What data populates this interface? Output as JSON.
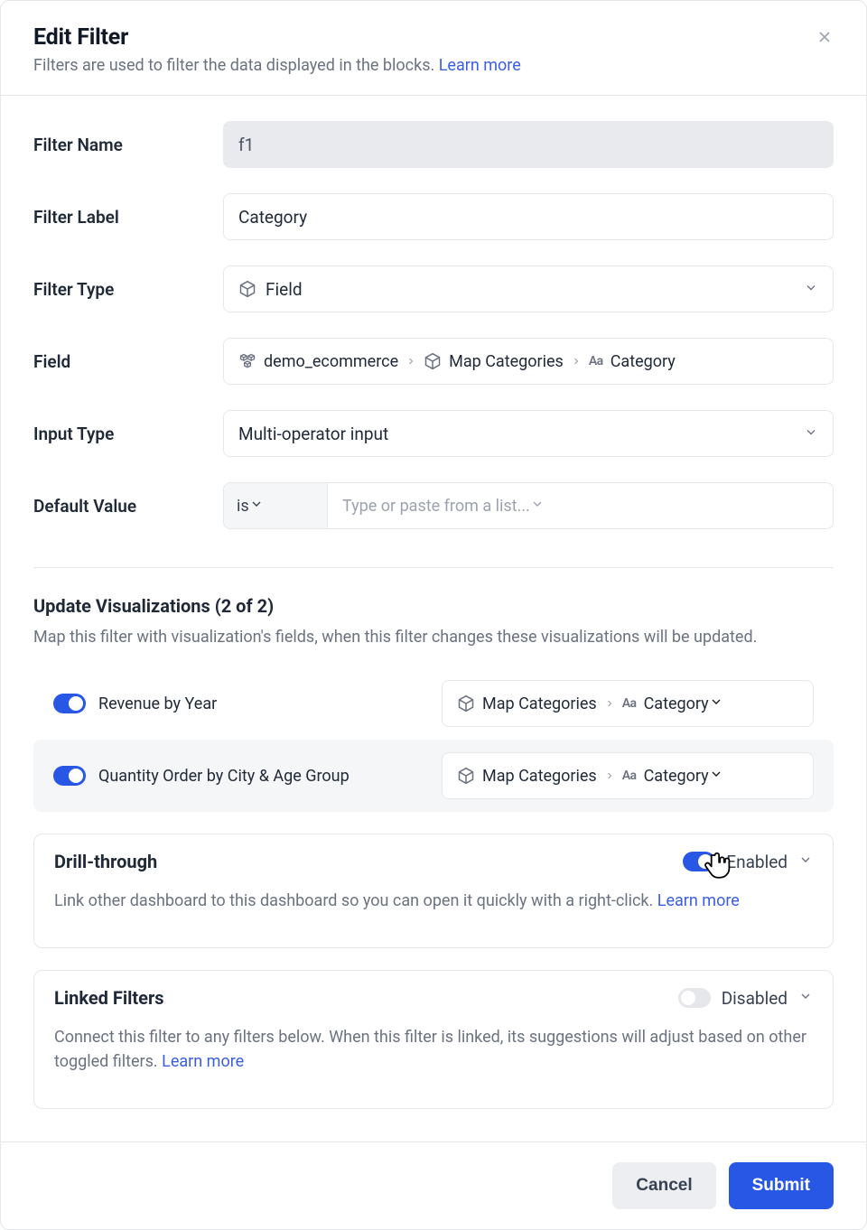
{
  "header": {
    "title": "Edit Filter",
    "subtitle": "Filters are used to filter the data displayed in the blocks.",
    "learn_more": "Learn more"
  },
  "form": {
    "filter_name": {
      "label": "Filter Name",
      "value": "f1"
    },
    "filter_label": {
      "label": "Filter Label",
      "value": "Category"
    },
    "filter_type": {
      "label": "Filter Type",
      "value": "Field"
    },
    "field": {
      "label": "Field",
      "path": [
        "demo_ecommerce",
        "Map Categories",
        "Category"
      ]
    },
    "input_type": {
      "label": "Input Type",
      "value": "Multi-operator input"
    },
    "default_value": {
      "label": "Default Value",
      "operator": "is",
      "placeholder": "Type or paste from a list..."
    }
  },
  "visualizations": {
    "title": "Update Visualizations (2 of 2)",
    "desc": "Map this filter with visualization's fields, when this filter changes these visualizations will be updated.",
    "items": [
      {
        "name": "Revenue by Year",
        "map_path": [
          "Map Categories",
          "Category"
        ]
      },
      {
        "name": "Quantity Order by City & Age Group",
        "map_path": [
          "Map Categories",
          "Category"
        ]
      }
    ]
  },
  "drill": {
    "title": "Drill-through",
    "state": "Enabled",
    "desc_prefix": "Link other dashboard to this dashboard so you can open it quickly with a right-click. ",
    "learn_more": "Learn more"
  },
  "linked": {
    "title": "Linked Filters",
    "state": "Disabled",
    "desc_prefix": "Connect this filter to any filters below. When this filter is linked, its suggestions will adjust based on other toggled filters. ",
    "learn_more": "Learn more"
  },
  "footer": {
    "cancel": "Cancel",
    "submit": "Submit"
  }
}
